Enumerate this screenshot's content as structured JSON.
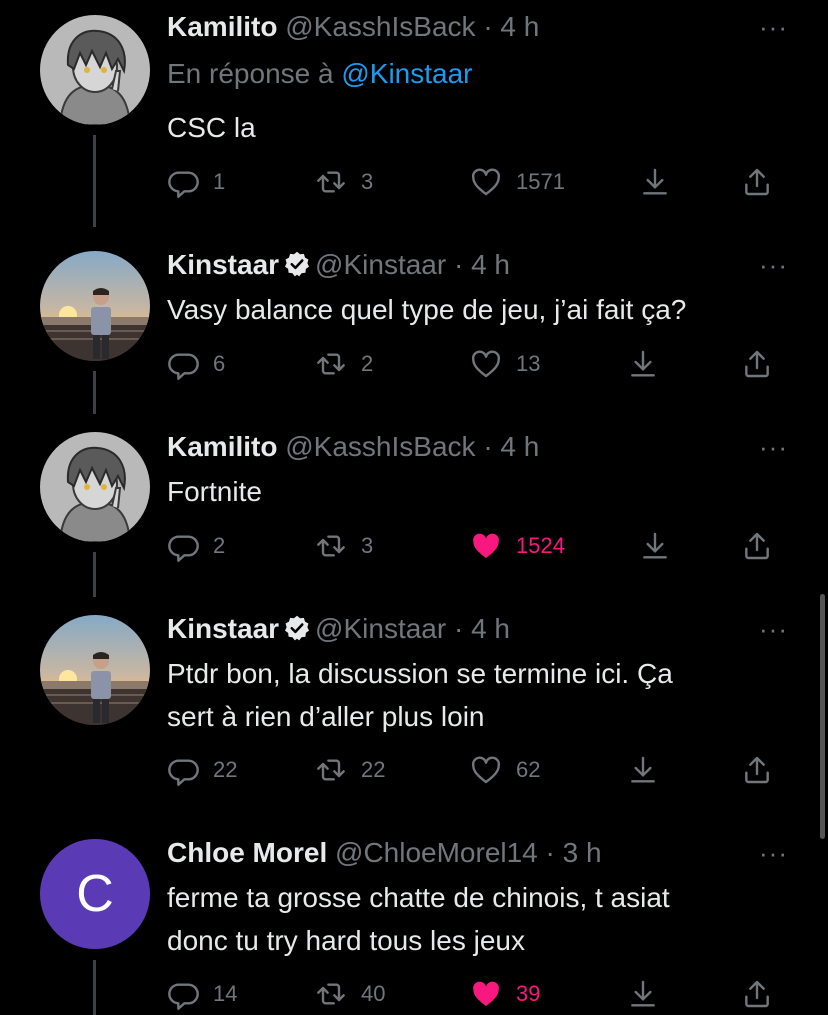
{
  "tweets": [
    {
      "name": "Kamilito",
      "handle": "@KasshIsBack",
      "sep": "·",
      "time": "4 h",
      "verified": false,
      "reply_prefix": "En réponse à ",
      "reply_mention": "@Kinstaar",
      "text": "CSC la",
      "replies": "1",
      "retweets": "3",
      "likes": "1571",
      "liked": false,
      "more": "···"
    },
    {
      "name": "Kinstaar",
      "handle": "@Kinstaar",
      "sep": "·",
      "time": "4 h",
      "verified": true,
      "text": "Vasy balance quel type de jeu, j’ai fait ça?",
      "replies": "6",
      "retweets": "2",
      "likes": "13",
      "liked": false,
      "more": "···"
    },
    {
      "name": "Kamilito",
      "handle": "@KasshIsBack",
      "sep": "·",
      "time": "4 h",
      "verified": false,
      "text": "Fortnite",
      "replies": "2",
      "retweets": "3",
      "likes": "1524",
      "liked": true,
      "more": "···"
    },
    {
      "name": "Kinstaar",
      "handle": "@Kinstaar",
      "sep": "·",
      "time": "4 h",
      "verified": true,
      "text_line1": "Ptdr bon, la discussion se termine ici. Ça",
      "text_line2": "sert à rien d’aller plus loin",
      "replies": "22",
      "retweets": "22",
      "likes": "62",
      "liked": false,
      "more": "···"
    },
    {
      "name": "Chloe Morel",
      "handle": "@ChloeMorel14",
      "sep": "·",
      "time": "3 h",
      "verified": false,
      "avatar_letter": "C",
      "text_line1": "ferme ta grosse chatte de chinois, t asiat",
      "text_line2": "donc tu try hard tous les jeux",
      "replies": "14",
      "retweets": "40",
      "likes": "39",
      "liked": true,
      "more": "···"
    }
  ],
  "colors": {
    "background": "#000000",
    "text": "#e7e9ea",
    "muted": "#71767b",
    "link": "#1d9bf0",
    "like": "#f91880",
    "avatar_c": "#5b3bb5"
  }
}
